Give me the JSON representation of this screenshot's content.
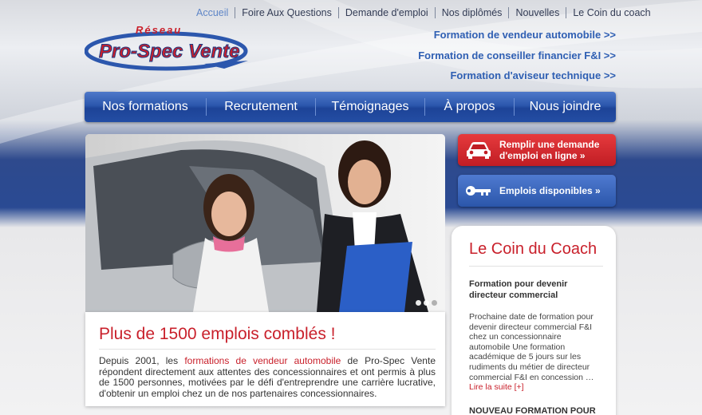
{
  "top_nav": [
    "Accueil",
    "Foire Aux Questions",
    "Demande d'emploi",
    "Nos diplômés",
    "Nouvelles",
    "Le Coin du coach"
  ],
  "logo": {
    "top_text": "Réseau",
    "main_text": "Pro-Spec Vente"
  },
  "formation_links": [
    "Formation de vendeur automobile >>",
    "Formation de conseiller financier F&I >>",
    "Formation d'aviseur technique >>"
  ],
  "main_nav": [
    "Nos formations",
    "Recrutement",
    "Témoignages",
    "À propos",
    "Nous joindre"
  ],
  "side_buttons": {
    "apply": {
      "label_line1": "Remplir une demande",
      "label_line2": "d'emploi en ligne »",
      "icon": "car-icon"
    },
    "jobs": {
      "label": "Emplois disponibles »",
      "icon": "key-icon"
    }
  },
  "main_card": {
    "title": "Plus de 1500 emplois comblés !",
    "text_before": "Depuis 2001, les ",
    "text_link": "formations de vendeur automobile",
    "text_after": " de Pro-Spec Vente répondent directement aux attentes des concessionnaires et ont permis à plus de 1500 personnes, motivées par le défi d'entreprendre une carrière lucrative, d'obtenir un emploi chez un de nos partenaires concessionnaires."
  },
  "coach": {
    "title": "Le Coin du Coach",
    "article1_title": "Formation pour devenir directeur commercial",
    "article1_body": "Prochaine date de formation pour devenir directeur commercial F&I chez un concessionnaire automobile Une formation académique de 5 jours sur les rudiments du métier de directeur commercial F&I en concession …",
    "article1_more": "Lire la suite [+]",
    "article2_title": "NOUVEAU FORMATION POUR DEVENIR AVISEUR TECHNIQUE"
  },
  "slider": {
    "dot_count": 3,
    "active_index": 0
  },
  "colors": {
    "brand_red": "#c9202b",
    "brand_blue": "#2c57ad",
    "link_blue": "#2f5fb3"
  }
}
